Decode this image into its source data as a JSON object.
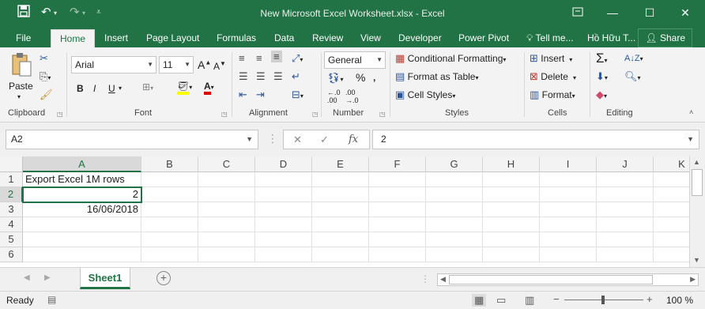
{
  "window": {
    "title": "New Microsoft Excel Worksheet.xlsx - Excel",
    "qa_save_icon": "save-icon",
    "qa_undo_icon": "undo-icon",
    "qa_redo_icon": "redo-icon"
  },
  "tabs": [
    "File",
    "Home",
    "Insert",
    "Page Layout",
    "Formulas",
    "Data",
    "Review",
    "View",
    "Developer",
    "Power Pivot"
  ],
  "active_tab": "Home",
  "tell_me": "Tell me...",
  "user": "Hồ Hữu T...",
  "share_label": "Share",
  "ribbon": {
    "clipboard": {
      "paste": "Paste",
      "label": "Clipboard"
    },
    "font": {
      "name": "Arial",
      "size": "11",
      "label": "Font"
    },
    "alignment": {
      "label": "Alignment"
    },
    "number": {
      "format": "General",
      "label": "Number",
      "percent": "%"
    },
    "styles": {
      "conditional": "Conditional Formatting",
      "as_table": "Format as Table",
      "cell_styles": "Cell Styles",
      "label": "Styles"
    },
    "cells": {
      "insert": "Insert",
      "delete": "Delete",
      "format": "Format",
      "label": "Cells"
    },
    "editing": {
      "label": "Editing"
    }
  },
  "formula_bar": {
    "name_box": "A2",
    "value": "2",
    "fx": "fx"
  },
  "grid": {
    "columns": [
      "A",
      "B",
      "C",
      "D",
      "E",
      "F",
      "G",
      "H",
      "I",
      "J",
      "K"
    ],
    "rows": [
      "1",
      "2",
      "3",
      "4",
      "5",
      "6"
    ],
    "cells": {
      "A1": "Export Excel 1M rows",
      "A2": "2",
      "A3": "16/06/2018"
    }
  },
  "sheets": [
    "Sheet1"
  ],
  "status": {
    "text": "Ready",
    "zoom": "100 %"
  },
  "colors": {
    "brand": "#217346"
  }
}
